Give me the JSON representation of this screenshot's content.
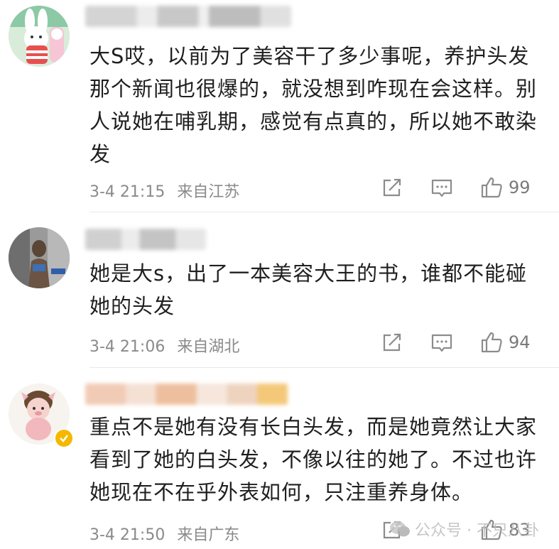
{
  "comments": [
    {
      "text": "大S哎，以前为了美容干了多少事呢，养护头发那个新闻也很爆的，就没想到咋现在会这样。别人说她在哺乳期，感觉有点真的，所以她不敢染发",
      "time": "3-4 21:15",
      "location": "来自江苏",
      "likes": "99",
      "avatar_icon": "cartoon-rabbit-avatar"
    },
    {
      "text": "她是大s，出了一本美容大王的书，谁都不能碰她的头发",
      "time": "3-4 21:06",
      "location": "来自湖北",
      "likes": "94",
      "avatar_icon": "photo-avatar"
    },
    {
      "text": "重点不是她有没有长白头发，而是她竟然让大家看到了她的白头发，不像以往的她了。不过也许她现在不在乎外表如何，只注重养身体。",
      "time": "3-4 21:50",
      "location": "来自广东",
      "likes": "83",
      "avatar_icon": "cartoon-pig-avatar",
      "verified_badge_color": "#f5b800"
    }
  ],
  "watermark": {
    "text": "公众号 · 不只八卦",
    "icon": "wechat-icon"
  },
  "colors": {
    "text": "#1f1f1f",
    "meta": "#8a8a8a",
    "icon": "#8c8c8c"
  }
}
